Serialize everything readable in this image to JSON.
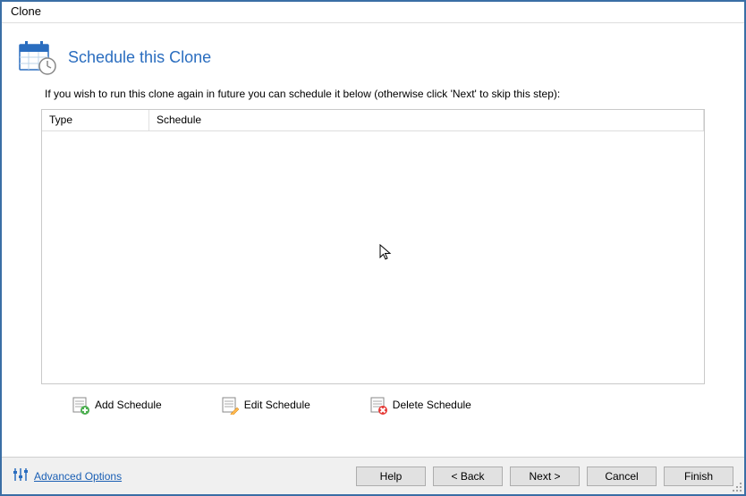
{
  "window": {
    "title": "Clone"
  },
  "heading": "Schedule this Clone",
  "intro": "If you wish to run this clone again in future you can schedule it below (otherwise click 'Next' to skip this step):",
  "table": {
    "columns": {
      "type": "Type",
      "schedule": "Schedule"
    },
    "rows": []
  },
  "actions": {
    "add": "Add Schedule",
    "edit": "Edit Schedule",
    "delete": "Delete Schedule"
  },
  "footer": {
    "advanced": "Advanced Options",
    "help": "Help",
    "back": "< Back",
    "next": "Next >",
    "cancel": "Cancel",
    "finish": "Finish"
  }
}
